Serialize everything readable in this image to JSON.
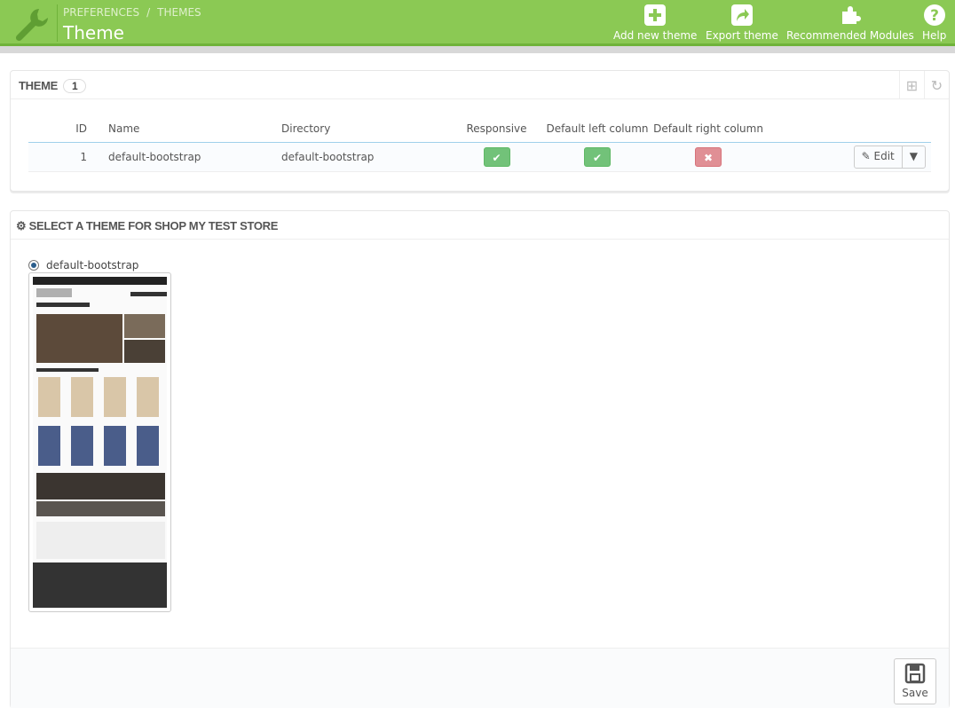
{
  "header": {
    "breadcrumb": [
      "PREFERENCES",
      "THEMES"
    ],
    "title": "Theme",
    "toolbar": [
      {
        "label": "Add new theme",
        "icon": "plus-square-icon"
      },
      {
        "label": "Export theme",
        "icon": "share-icon"
      },
      {
        "label": "Recommended Modules",
        "icon": "puzzle-icon"
      },
      {
        "label": "Help",
        "icon": "question-circle-icon"
      }
    ]
  },
  "themes_panel": {
    "title": "THEME",
    "count": "1",
    "columns": [
      "ID",
      "Name",
      "Directory",
      "Responsive",
      "Default left column",
      "Default right column"
    ],
    "rows": [
      {
        "id": "1",
        "name": "default-bootstrap",
        "directory": "default-bootstrap",
        "responsive": true,
        "left_column": true,
        "right_column": false,
        "edit_label": "Edit"
      }
    ]
  },
  "select_panel": {
    "title": "SELECT A THEME FOR SHOP MY TEST STORE",
    "option_label": "default-bootstrap",
    "selected": true,
    "save_label": "Save"
  },
  "colors": {
    "header": "#8bc954",
    "success": "#72c279",
    "danger": "#e08f95"
  }
}
